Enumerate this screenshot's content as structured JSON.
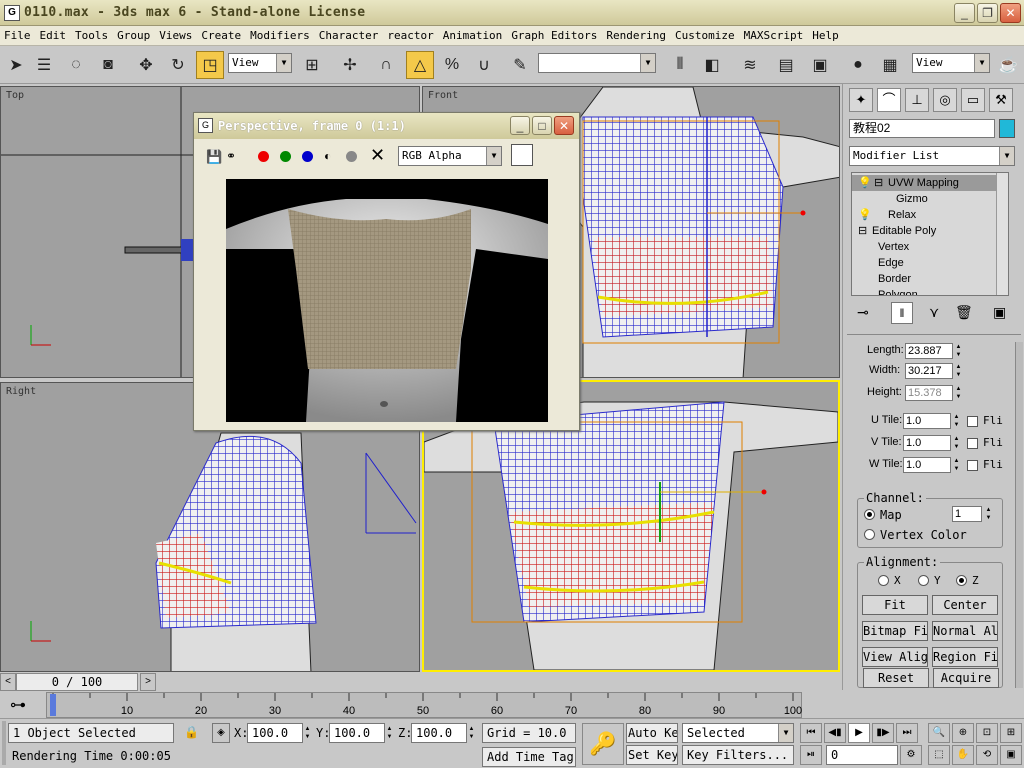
{
  "window": {
    "title": "0110.max - 3ds max 6 - Stand-alone License",
    "icon": "3ds-max-logo-icon"
  },
  "menu": [
    "File",
    "Edit",
    "Tools",
    "Group",
    "Views",
    "Create",
    "Modifiers",
    "Character",
    "reactor",
    "Animation",
    "Graph Editors",
    "Rendering",
    "Customize",
    "MAXScript",
    "Help"
  ],
  "toolbar": {
    "reference_coord": "View",
    "named_selection": "",
    "render_view": "View"
  },
  "viewports": {
    "top": "Top",
    "front": "Front",
    "right": "Right",
    "perspective": ""
  },
  "render_window": {
    "title": "Perspective, frame 0 (1:1)",
    "channel": "RGB Alpha"
  },
  "command_panel": {
    "object_name": "教程02",
    "object_color": "#20b8d8",
    "modifier_list": "Modifier List",
    "stack": [
      {
        "label": "UVW Mapping",
        "level": 0,
        "selected": true
      },
      {
        "label": "Gizmo",
        "level": 1,
        "selected": false
      },
      {
        "label": "Relax",
        "level": 0,
        "selected": false
      },
      {
        "label": "Editable Poly",
        "level": 0,
        "selected": false
      },
      {
        "label": "Vertex",
        "level": 1,
        "selected": false
      },
      {
        "label": "Edge",
        "level": 1,
        "selected": false
      },
      {
        "label": "Border",
        "level": 1,
        "selected": false
      },
      {
        "label": "Polygon",
        "level": 1,
        "selected": false
      }
    ],
    "params": {
      "length_label": "Length:",
      "length": "23.887",
      "width_label": "Width:",
      "width": "30.217",
      "height_label": "Height:",
      "height": "15.378",
      "utile_label": "U Tile:",
      "utile": "1.0",
      "vtile_label": "V Tile:",
      "vtile": "1.0",
      "wtile_label": "W Tile:",
      "wtile": "1.0",
      "flip": "Fli"
    },
    "channel": {
      "title": "Channel:",
      "map": "Map",
      "map_value": "1",
      "vertex_color": "Vertex Color"
    },
    "alignment": {
      "title": "Alignment:",
      "x": "X",
      "y": "Y",
      "z": "Z",
      "fit": "Fit",
      "center": "Center",
      "bitmap_fit": "Bitmap Fit",
      "normal_align": "Normal Align",
      "view_align": "View Align",
      "region_fit": "Region Fit",
      "reset": "Reset",
      "acquire": "Acquire"
    }
  },
  "timeline": {
    "frame_counter": "0 / 100",
    "ticks": [
      "0",
      "10",
      "20",
      "30",
      "40",
      "50",
      "60",
      "70",
      "80",
      "90",
      "100"
    ]
  },
  "status": {
    "selection": "1 Object Selected",
    "prompt": "Rendering Time  0:00:05",
    "x_label": "X:",
    "x": "100.0",
    "y_label": "Y:",
    "y": "100.0",
    "z_label": "Z:",
    "z": "100.0",
    "grid": "Grid = 10.0",
    "add_time_tag": "Add Time Tag",
    "auto_key": "Auto Key",
    "set_key": "Set Key",
    "key_mode": "Selected",
    "key_filters": "Key Filters...",
    "current_frame": "0"
  }
}
